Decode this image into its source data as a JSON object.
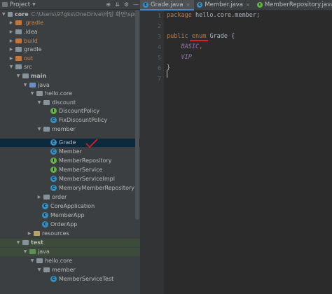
{
  "project_panel": {
    "title": "Project",
    "tree": [
      {
        "label": "core",
        "hint": "C:\\Users\\97gks\\OneDrive\\바탕 화면\\spr",
        "kind": "module"
      },
      {
        "label": ".gradle",
        "kind": "excluded"
      },
      {
        "label": ".idea",
        "kind": "folder"
      },
      {
        "label": "build",
        "kind": "excluded"
      },
      {
        "label": "gradle",
        "kind": "folder"
      },
      {
        "label": "out",
        "kind": "excluded"
      },
      {
        "label": "src",
        "kind": "folder"
      },
      {
        "label": "main",
        "kind": "folder"
      },
      {
        "label": "java",
        "kind": "src"
      },
      {
        "label": "hello.core",
        "kind": "pkg"
      },
      {
        "label": "discount",
        "kind": "pkg"
      },
      {
        "label": "DiscountPolicy",
        "kind": "interface"
      },
      {
        "label": "FixDiscountPolicy",
        "kind": "class"
      },
      {
        "label": "member",
        "kind": "pkg"
      },
      {
        "label": "Grade",
        "kind": "enum"
      },
      {
        "label": "Member",
        "kind": "class"
      },
      {
        "label": "MemberRepository",
        "kind": "interface"
      },
      {
        "label": "MemberService",
        "kind": "interface"
      },
      {
        "label": "MemberServiceImpl",
        "kind": "class"
      },
      {
        "label": "MemoryMemberRepository",
        "kind": "class"
      },
      {
        "label": "order",
        "kind": "pkg"
      },
      {
        "label": "CoreApplication",
        "kind": "class"
      },
      {
        "label": "MemberApp",
        "kind": "class"
      },
      {
        "label": "OrderApp",
        "kind": "class"
      },
      {
        "label": "resources",
        "kind": "res"
      },
      {
        "label": "test",
        "kind": "folder"
      },
      {
        "label": "java",
        "kind": "test"
      },
      {
        "label": "hello.core",
        "kind": "pkg"
      },
      {
        "label": "member",
        "kind": "pkg"
      },
      {
        "label": "MemberServiceTest",
        "kind": "class"
      }
    ]
  },
  "tabs": [
    {
      "label": "Grade.java",
      "active": true
    },
    {
      "label": "Member.java",
      "active": false
    },
    {
      "label": "MemberRepository.java",
      "active": false
    }
  ],
  "editor": {
    "line_numbers": [
      "1",
      "2",
      "3",
      "4",
      "5",
      "6",
      "7"
    ],
    "line1_kw": "package",
    "line1_rest": " hello.core.member;",
    "line3_public": "public",
    "line3_enum": "enum",
    "line3_rest": " Grade {",
    "line4_basic": "BASIC",
    "line4_comma": ",",
    "line5_vip": "VIP",
    "line6": "}"
  },
  "colors": {
    "keyword": "#cc7832",
    "enum_constant": "#9876aa",
    "annotation_mark": "#e02020"
  }
}
